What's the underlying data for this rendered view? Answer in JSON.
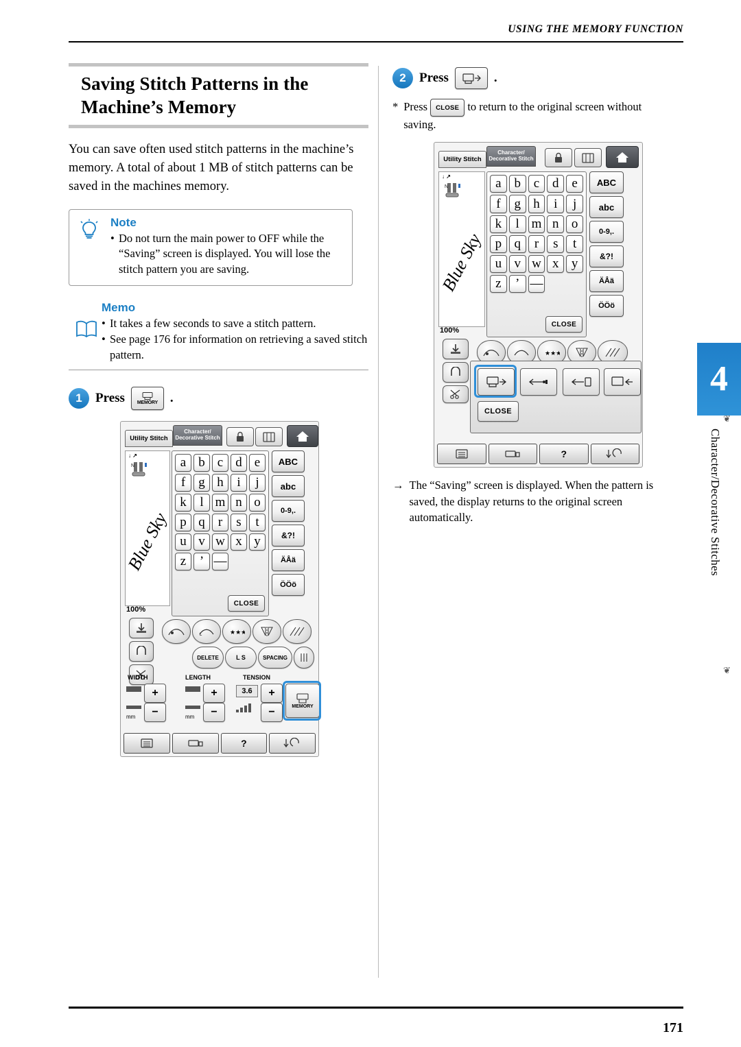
{
  "header": {
    "running_title": "USING THE MEMORY FUNCTION"
  },
  "footer": {
    "page_number": "171"
  },
  "chapter": {
    "number": "4",
    "side_title": "Character/Decorative Stitches"
  },
  "left_column": {
    "title": "Saving Stitch Patterns in the Machine’s Memory",
    "intro": "You can save often used stitch patterns in the machine’s memory. A total of about 1 MB of stitch patterns can be saved in the machines memory.",
    "note": {
      "label": "Note",
      "icon": "lightbulb-icon",
      "body": "Do not turn the main power to OFF while the “Saving” screen is displayed. You will lose the stitch pattern you are saving."
    },
    "memo": {
      "label": "Memo",
      "icon": "book-icon",
      "items": [
        "It takes a few seconds to save a stitch pattern.",
        "See page 176 for information on retrieving a saved stitch pattern."
      ]
    },
    "step": {
      "number": "1",
      "text": "Press",
      "button_label": "MEMORY",
      "period": "."
    },
    "screen": {
      "tabs": {
        "utility": "Utility Stitch",
        "character": "Character/ Decorative Stitch"
      },
      "keyboard_rows": [
        [
          "a",
          "b",
          "c",
          "d",
          "e"
        ],
        [
          "f",
          "g",
          "h",
          "i",
          "j"
        ],
        [
          "k",
          "l",
          "m",
          "n",
          "o"
        ],
        [
          "p",
          "q",
          "r",
          "s",
          "t"
        ],
        [
          "u",
          "v",
          "w",
          "x",
          "y"
        ],
        [
          "z",
          "’",
          "—"
        ]
      ],
      "right_keys": [
        "ABC",
        "abc",
        "0-9,.",
        "&?!",
        "ÄÅä",
        "ÖÖö"
      ],
      "close_label": "CLOSE",
      "zoom_label": "100%",
      "preview_text": "Blue Sky",
      "edit_buttons": [
        "DELETE",
        "L S",
        "SPACING"
      ],
      "setting_labels": [
        "WIDTH",
        "LENGTH",
        "TENSION"
      ],
      "tension_value": "3.6",
      "unit_label": "mm",
      "memory_key": "MEMORY",
      "bottom_bar": [
        "list-icon",
        "machine-icon",
        "?",
        "return-icon"
      ]
    }
  },
  "right_column": {
    "step": {
      "number": "2",
      "text": "Press",
      "button_label": "save-icon",
      "period": "."
    },
    "star_note": {
      "prefix": "Press",
      "button_label": "CLOSE",
      "text": "to return to the original screen without saving."
    },
    "arrow_note": "The “Saving” screen is displayed. When the pattern is saved, the display returns to the original screen automatically.",
    "screen": {
      "tabs": {
        "utility": "Utility Stitch",
        "character": "Character/ Decorative Stitch"
      },
      "keyboard_rows": [
        [
          "a",
          "b",
          "c",
          "d",
          "e"
        ],
        [
          "f",
          "g",
          "h",
          "i",
          "j"
        ],
        [
          "k",
          "l",
          "m",
          "n",
          "o"
        ],
        [
          "p",
          "q",
          "r",
          "s",
          "t"
        ],
        [
          "u",
          "v",
          "w",
          "x",
          "y"
        ],
        [
          "z",
          "’",
          "—"
        ]
      ],
      "right_keys": [
        "ABC",
        "abc",
        "0-9,.",
        "&?!",
        "ÄÅä",
        "ÖÖö"
      ],
      "close_label": "CLOSE",
      "zoom_label": "100%",
      "preview_text": "Blue Sky",
      "dialog_close_label": "CLOSE",
      "bottom_bar": [
        "list-icon",
        "machine-icon",
        "?",
        "return-icon"
      ]
    }
  }
}
